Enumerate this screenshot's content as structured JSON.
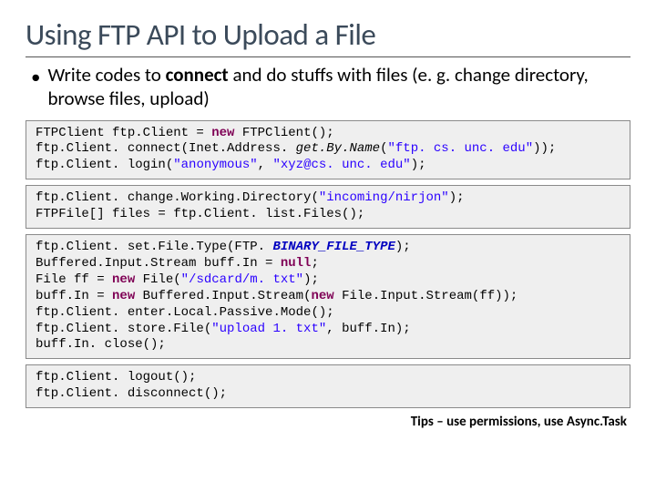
{
  "title": "Using FTP API to Upload a File",
  "bullet": {
    "pre": "Write codes to ",
    "bold": "connect",
    "post": " and do stuffs with files (e. g. change directory, browse files, upload)"
  },
  "code1": {
    "l1a": "FTPClient ftp.Client = ",
    "l1kw": "new",
    "l1b": " FTPClient();",
    "l2a": "ftp.Client. connect(Inet.Address. ",
    "l2i": "get.By.Name",
    "l2b": "(",
    "l2s": "\"ftp. cs. unc. edu\"",
    "l2c": "));",
    "l3a": "ftp.Client. login(",
    "l3s1": "\"anonymous\"",
    "l3m": ", ",
    "l3s2": "\"xyz@cs. unc. edu\"",
    "l3b": ");"
  },
  "code2": {
    "l1a": "ftp.Client. change.Working.Directory(",
    "l1s": "\"incoming/nirjon\"",
    "l1b": ");",
    "l2": "FTPFile[] files = ftp.Client. list.Files();"
  },
  "code3": {
    "l1a": "ftp.Client. set.File.Type(FTP. ",
    "l1c": "BINARY_FILE_TYPE",
    "l1b": ");",
    "l2a": "Buffered.Input.Stream buff.In = ",
    "l2kw": "null",
    "l2b": ";",
    "l3a": "File ff = ",
    "l3kw": "new",
    "l3b": " File(",
    "l3s": "\"/sdcard/m. txt\"",
    "l3c": ");",
    "l4a": "buff.In = ",
    "l4kw1": "new",
    "l4b": " Buffered.Input.Stream(",
    "l4kw2": "new",
    "l4c": " File.Input.Stream(ff));",
    "l5": "ftp.Client. enter.Local.Passive.Mode();",
    "l6a": "ftp.Client. store.File(",
    "l6s": "\"upload 1. txt\"",
    "l6b": ", buff.In);",
    "l7": "buff.In. close();"
  },
  "code4": {
    "l1": "ftp.Client. logout();",
    "l2": "ftp.Client. disconnect();"
  },
  "tips": "Tips – use permissions, use Async.Task"
}
